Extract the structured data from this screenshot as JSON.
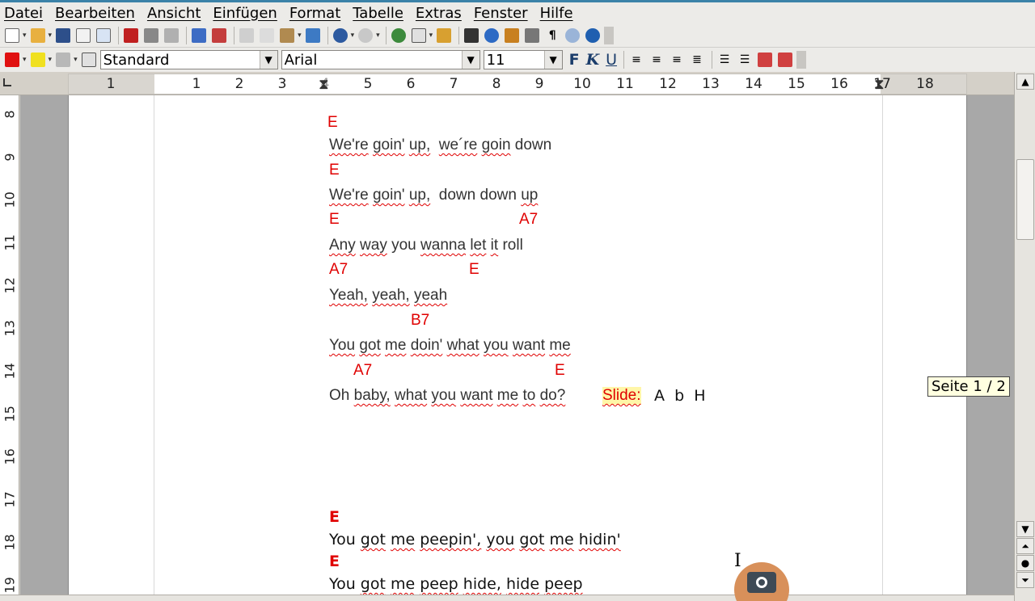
{
  "menu": [
    "Datei",
    "Bearbeiten",
    "Ansicht",
    "Einfügen",
    "Format",
    "Tabelle",
    "Extras",
    "Fenster",
    "Hilfe"
  ],
  "format_toolbar": {
    "style_value": "Standard",
    "font_value": "Arial",
    "size_value": "11",
    "bold": "F",
    "italic": "K",
    "underline": "U"
  },
  "ruler": {
    "numbers": [
      "1",
      "1",
      "2",
      "3",
      "4",
      "5",
      "6",
      "7",
      "8",
      "9",
      "10",
      "11",
      "12",
      "13",
      "14",
      "15",
      "16",
      "17",
      "18"
    ]
  },
  "vruler": {
    "numbers": [
      "8",
      "9",
      "10",
      "11",
      "12",
      "13",
      "14",
      "15",
      "16",
      "17",
      "18",
      "19"
    ]
  },
  "document": {
    "c1": "E",
    "l1a": "We're",
    "l1b": "goin'",
    "l1c": "up,",
    "l1d": "we´re",
    "l1e": "goin",
    "l1f": "down",
    "c2": "E",
    "l2a": "We're",
    "l2b": "goin'",
    "l2c": "up,",
    "l2d": "down down",
    "l2e": "up",
    "c3a": "E",
    "c3b": "A7",
    "l3a": "Any",
    "l3b": "way",
    "l3c": "you",
    "l3d": "wanna",
    "l3e": "let",
    "l3f": "it",
    "l3g": "roll",
    "c4a": "A7",
    "c4b": "E",
    "l4a": "Yeah,",
    "l4b": "yeah,",
    "l4c": "yeah",
    "c5": "B7",
    "l5a": "You",
    "l5b": "got",
    "l5c": "me",
    "l5d": "doin'",
    "l5e": "what",
    "l5f": "you",
    "l5g": "want",
    "l5h": "me",
    "c6a": "A7",
    "c6b": "E",
    "l6a": "Oh",
    "l6b": "baby,",
    "l6c": "what",
    "l6d": "you",
    "l6e": "want",
    "l6f": "me",
    "l6g": "to",
    "l6h": "do?",
    "slide": "Slide:",
    "slide_notes": "A  b  H",
    "c7": "E",
    "l7a": "You",
    "l7b": "got",
    "l7c": "me",
    "l7d": "peepin',",
    "l7e": "you",
    "l7f": "got",
    "l7g": "me",
    "l7h": "hidin'",
    "c8": "E",
    "l8a": "You",
    "l8b": "got",
    "l8c": "me",
    "l8d": "peep",
    "l8e": "hide,",
    "l8f": "hide",
    "l8g": "peep"
  },
  "tooltip": "Seite 1 / 2",
  "colors": {
    "chord": "#e00000",
    "slide_highlight": "#fff6a8",
    "menubar_accent": "#3b82a8"
  }
}
